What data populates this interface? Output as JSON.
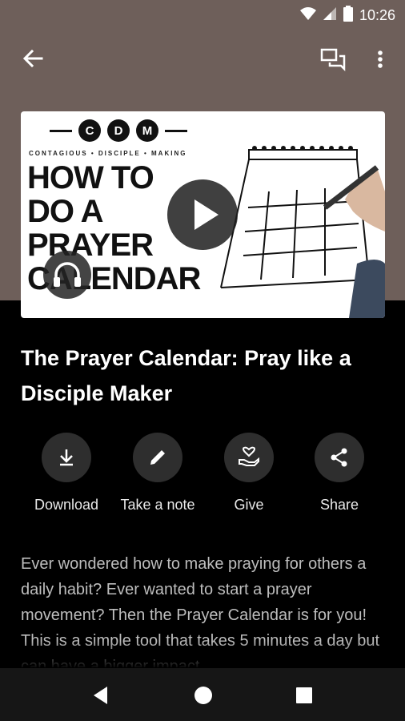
{
  "status_bar": {
    "time": "10:26",
    "icons": [
      "wifi-icon",
      "signal-icon",
      "battery-icon"
    ]
  },
  "app_bar": {
    "icons": [
      "back-arrow-icon",
      "chat-icon",
      "more-vert-icon"
    ]
  },
  "video": {
    "thumbnail": {
      "logo_letters": [
        "C",
        "D",
        "M"
      ],
      "tagline": "CONTAGIOUS • DISCIPLE • MAKING",
      "title_lines": [
        "HOW TO",
        "DO A",
        "PRAYER",
        "CALENDAR"
      ]
    },
    "icons": [
      "play-icon",
      "headphones-icon"
    ]
  },
  "title": "The Prayer Calendar: Pray like a Disciple Maker",
  "actions": [
    {
      "label": "Download",
      "icon": "download-icon"
    },
    {
      "label": "Take a note",
      "icon": "pencil-icon"
    },
    {
      "label": "Give",
      "icon": "give-heart-hand-icon"
    },
    {
      "label": "Share",
      "icon": "share-icon"
    }
  ],
  "description": "Ever wondered how to make praying for others a daily habit? Ever wanted to start a prayer movement? Then the Prayer Calendar is for you! This is a simple tool that takes 5 minutes a day but can have a bigger impact",
  "nav_bar": {
    "icons": [
      "back-triangle-icon",
      "home-circle-icon",
      "recents-square-icon"
    ]
  },
  "colors": {
    "header_bg": "#6e5f5a",
    "page_bg": "#000000",
    "action_circle": "#2e2e2e",
    "nav_bg": "#161616"
  }
}
